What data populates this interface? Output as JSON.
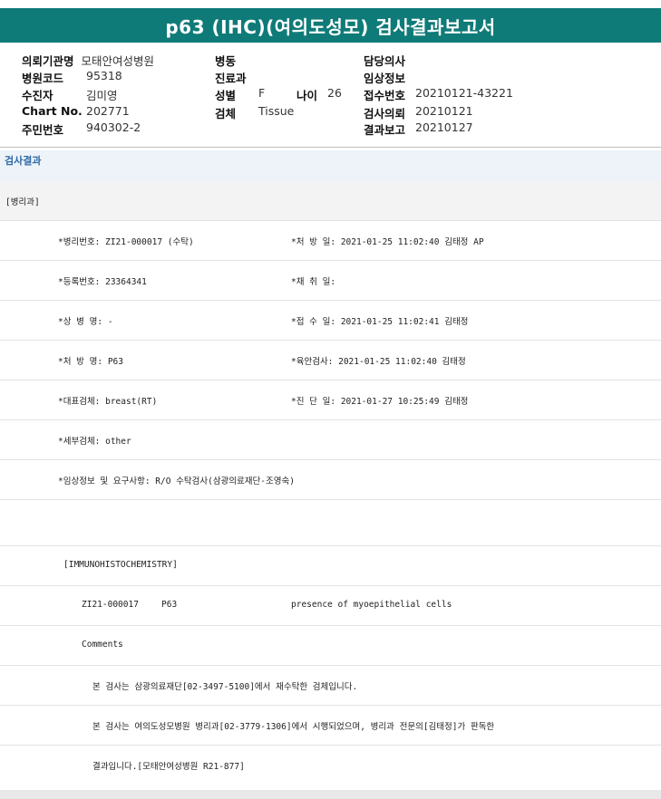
{
  "title": "p63 (IHC)(여의도성모) 검사결과보고서",
  "header": {
    "hospital_label": "의뢰기관명",
    "hospital_value": "모태안여성병원",
    "code_label": "병원코드",
    "code_value": "95318",
    "patient_label": "수진자",
    "patient_value": "김미영",
    "chart_label": "Chart No.",
    "chart_value": "202771",
    "id_label": "주민번호",
    "id_value": "940302-2",
    "ward_label": "병동",
    "dept_label": "진료과",
    "sex_label": "성별",
    "sex_value": "F",
    "age_label": "나이",
    "age_value": "26",
    "specimen_label": "검체",
    "specimen_value": "Tissue",
    "doctor_label": "담당의사",
    "clinical_label": "임상정보",
    "receipt_label": "접수번호",
    "receipt_value": "20210121-43221",
    "request_label": "검사의뢰",
    "request_value": "20210121",
    "report_label": "결과보고",
    "report_value": "20210127"
  },
  "section_title": "검사결과",
  "rows": {
    "dept": "[병리과]",
    "path_no": "*병리번호: ZI21-000017 (수탁)",
    "order_date": "*처 방 일: 2021-01-25 11:02:40  김태정 AP",
    "reg_no": "*등록번호: 23364341",
    "collect_date": "*채 취 일:",
    "diagnosis": "*상 병 명: -",
    "receipt_date": "*접 수 일: 2021-01-25 11:02:41  김태정",
    "order_name": "*처 방 명: P63",
    "gross_exam": "*육안검사: 2021-01-25 11:02:40  김태정",
    "rep_specimen": "*대표검체: breast(RT)",
    "diag_date": "*진 단 일: 2021-01-27 10:25:49  김태정",
    "sub_specimen": "*세부검체: other",
    "clinical_info": "*임상정보 및 요구사항: R/O 수탁검사(삼광의료재단-조영숙)",
    "ihc_header": "[IMMUNOHISTOCHEMISTRY]",
    "ihc_id": "ZI21-000017",
    "ihc_marker": "P63",
    "ihc_result": "presence of myoepithelial cells",
    "comments": "Comments",
    "note1": "본 검사는 삼광의료재단[02-3497-5100]에서 재수탁한 검체입니다.",
    "note2": "본 검사는 여의도성모병원 병리과[02-3779-1306]에서 시행되었으며, 병리과 전문의[김태정]가 판독한",
    "note3": "결과입니다.[모태안여성병원 R21-877]"
  }
}
